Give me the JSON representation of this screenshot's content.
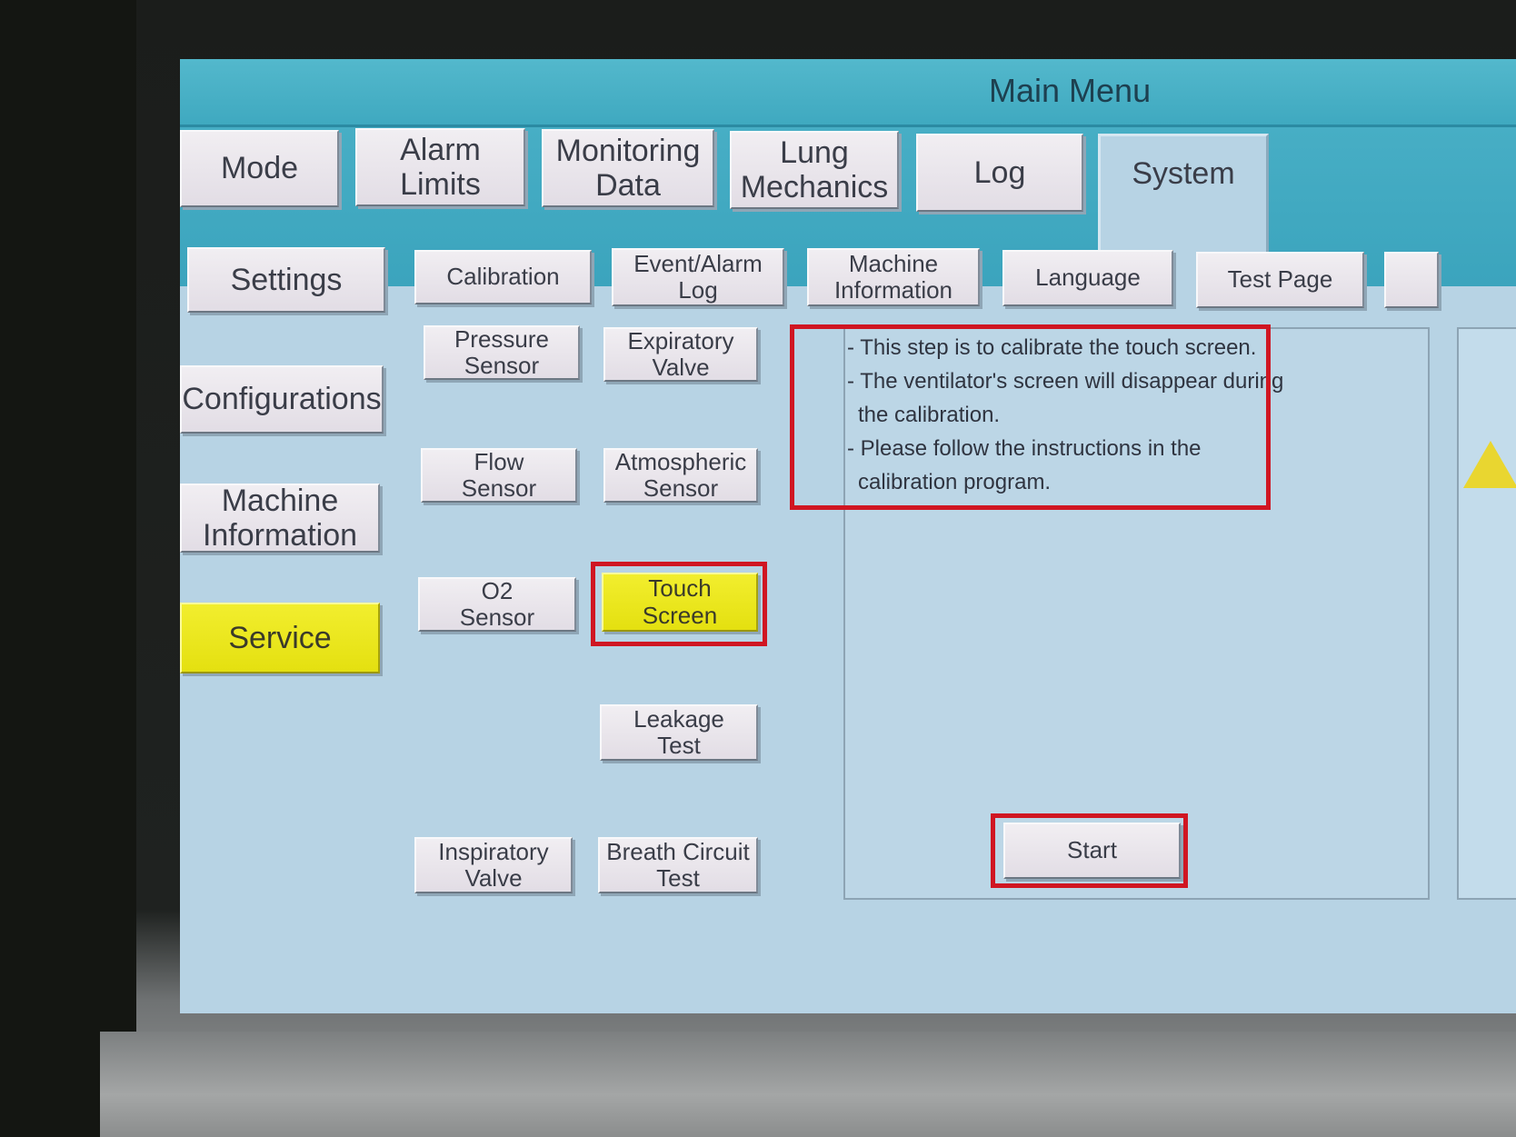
{
  "window": {
    "title": "Main Menu"
  },
  "tabs": [
    {
      "label": "Mode"
    },
    {
      "label": "Alarm\nLimits"
    },
    {
      "label": "Monitoring\nData"
    },
    {
      "label": "Lung\nMechanics"
    },
    {
      "label": "Log"
    },
    {
      "label": "System",
      "active": true
    }
  ],
  "sidebar": {
    "items": [
      {
        "label": "Settings"
      },
      {
        "label": "Configurations"
      },
      {
        "label": "Machine\nInformation"
      },
      {
        "label": "Service",
        "selected": true
      }
    ]
  },
  "subtabs": [
    {
      "label": "Calibration"
    },
    {
      "label": "Event/Alarm\nLog"
    },
    {
      "label": "Machine\nInformation"
    },
    {
      "label": "Language"
    },
    {
      "label": "Test Page"
    }
  ],
  "service_buttons": [
    {
      "label": "Pressure\nSensor"
    },
    {
      "label": "Expiratory\nValve"
    },
    {
      "label": "Flow\nSensor"
    },
    {
      "label": "Atmospheric\nSensor"
    },
    {
      "label": "O2\nSensor"
    },
    {
      "label": "Touch\nScreen",
      "selected": true
    },
    {
      "label": "Leakage\nTest"
    },
    {
      "label": "Inspiratory\nValve"
    },
    {
      "label": "Breath Circuit\nTest"
    }
  ],
  "instructions": [
    "- This step is to calibrate the touch screen.",
    "- The ventilator's screen will disappear during",
    "the calibration.",
    "- Please follow the instructions in the",
    "calibration program."
  ],
  "start_button": {
    "label": "Start"
  },
  "colors": {
    "title_bar": "#47aec5",
    "screen_bg": "#b7d3e4",
    "selected": "#e8e41c",
    "highlight_box": "#d01622"
  }
}
